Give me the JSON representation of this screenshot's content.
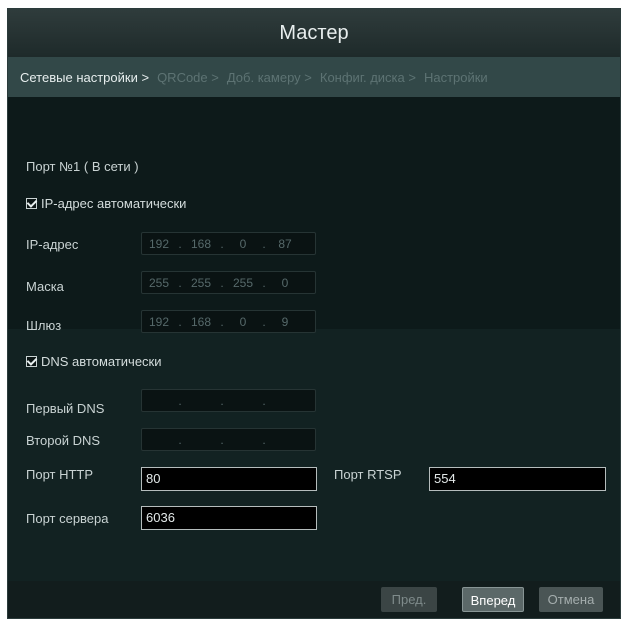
{
  "window": {
    "title": "Мастер"
  },
  "steps": [
    {
      "label": "Сетевые настройки >",
      "active": true
    },
    {
      "label": "QRCode >",
      "active": false
    },
    {
      "label": "Доб. камеру >",
      "active": false
    },
    {
      "label": "Конфиг. диска >",
      "active": false
    },
    {
      "label": "Настройки",
      "active": false
    }
  ],
  "network": {
    "port_title": "Порт №1 ( В сети )",
    "auto_ip_label": "IP-адрес автоматически",
    "auto_ip_checked": true,
    "ip_label": "IP-адрес",
    "ip_value": [
      "192",
      "168",
      "0",
      "87"
    ],
    "mask_label": "Маска",
    "mask_value": [
      "255",
      "255",
      "255",
      "0"
    ],
    "gateway_label": "Шлюз",
    "gateway_value": [
      "192",
      "168",
      "0",
      "9"
    ],
    "auto_dns_label": "DNS автоматически",
    "auto_dns_checked": true,
    "dns1_label": "Первый DNS",
    "dns2_label": "Второй DNS",
    "http_port_label": "Порт HTTP",
    "http_port_value": "80",
    "rtsp_port_label": "Порт RTSP",
    "rtsp_port_value": "554",
    "server_port_label": "Порт сервера",
    "server_port_value": "6036"
  },
  "footer": {
    "prev_label": "Пред.",
    "next_label": "Вперед",
    "cancel_label": "Отмена"
  }
}
